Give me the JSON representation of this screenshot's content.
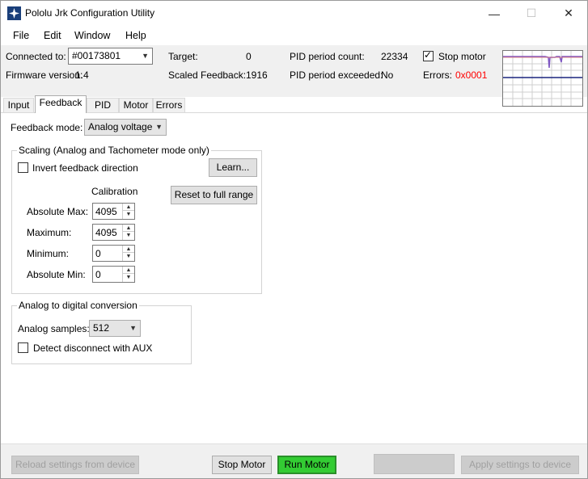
{
  "window": {
    "title": "Pololu Jrk Configuration Utility",
    "controls": {
      "minimize": "—",
      "maximize": "☐",
      "close": "✕"
    }
  },
  "menu": [
    "File",
    "Edit",
    "Window",
    "Help"
  ],
  "info": {
    "connected_label": "Connected to:",
    "connected_value": "#00173801",
    "firmware_label": "Firmware version:",
    "firmware_value": "1.4",
    "target_label": "Target:",
    "target_value": "0",
    "scaled_feedback_label": "Scaled Feedback:",
    "scaled_feedback_value": "1916",
    "pid_count_label": "PID period count:",
    "pid_count_value": "22334",
    "pid_exceeded_label": "PID period exceeded:",
    "pid_exceeded_value": "No",
    "stop_motor_label": "Stop motor",
    "stop_motor_checked": true,
    "errors_label": "Errors:",
    "errors_value": "0x0001",
    "errors_color": "#ff0000"
  },
  "tabs": [
    "Input",
    "Feedback",
    "PID",
    "Motor",
    "Errors"
  ],
  "active_tab": "Feedback",
  "feedback": {
    "mode_label": "Feedback mode:",
    "mode_value": "Analog voltage",
    "scaling": {
      "title": "Scaling (Analog and Tachometer mode only)",
      "invert_label": "Invert feedback direction",
      "invert_checked": false,
      "learn_button": "Learn...",
      "reset_button": "Reset to full range",
      "calibration_label": "Calibration",
      "rows": [
        {
          "label": "Absolute Max:",
          "value": "4095"
        },
        {
          "label": "Maximum:",
          "value": "4095"
        },
        {
          "label": "Minimum:",
          "value": "0"
        },
        {
          "label": "Absolute Min:",
          "value": "0"
        }
      ]
    },
    "adc": {
      "title": "Analog to digital conversion",
      "samples_label": "Analog samples:",
      "samples_value": "512",
      "detect_label": "Detect disconnect with AUX",
      "detect_checked": false
    }
  },
  "bottom": {
    "reload_button": "Reload settings from device",
    "stop_button": "Stop Motor",
    "run_button": "Run Motor",
    "run_color": "#33cc33",
    "apply_button": "Apply settings to device"
  }
}
